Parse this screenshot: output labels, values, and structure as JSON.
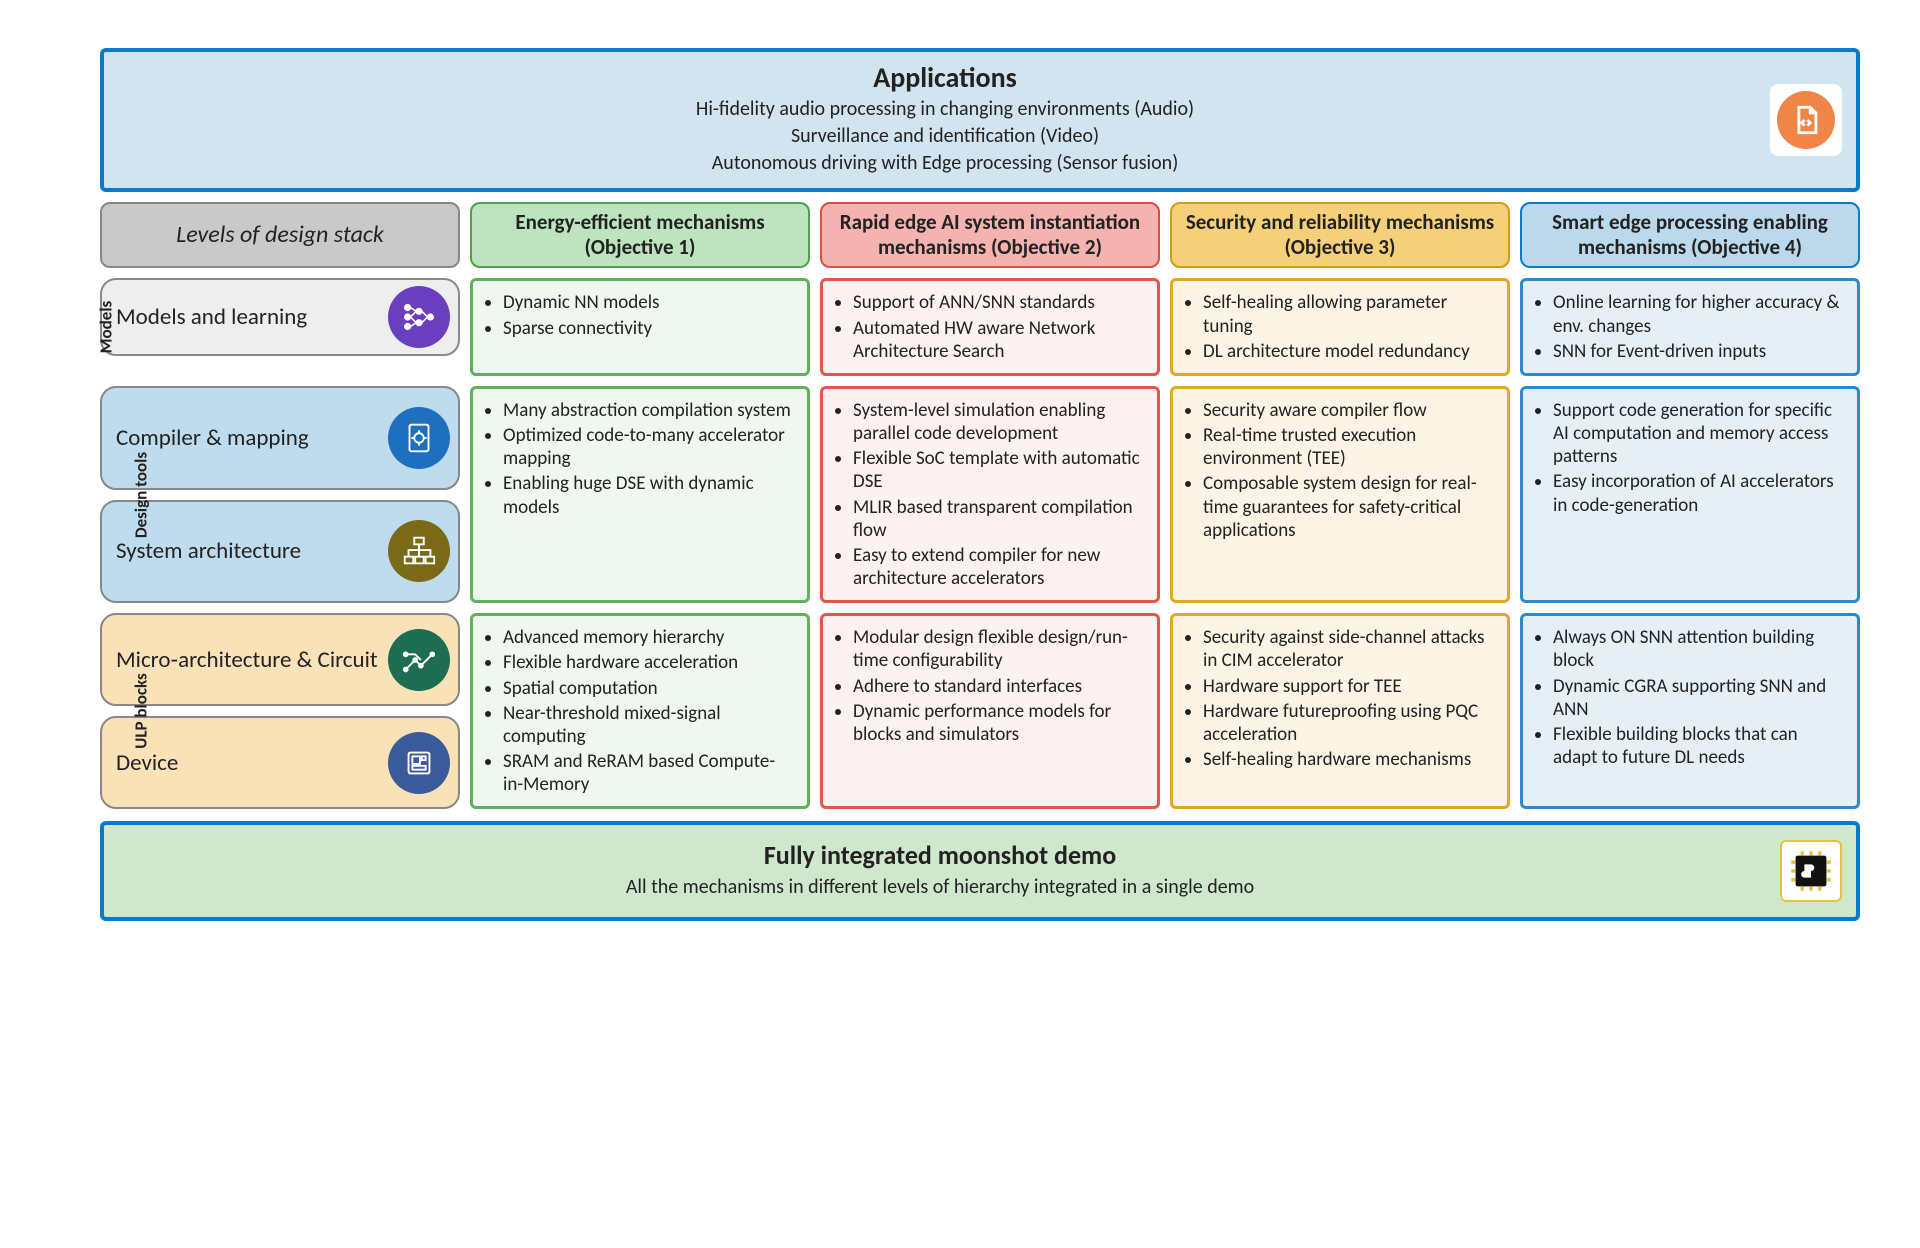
{
  "applications": {
    "title": "Applications",
    "lines": [
      "Hi-fidelity audio processing in changing environments (Audio)",
      "Surveillance and identification (Video)",
      "Autonomous driving with Edge processing (Sensor fusion)"
    ],
    "icon": "code-document-icon"
  },
  "header": {
    "levels_label": "Levels of design stack",
    "columns": [
      {
        "id": "obj1",
        "label": "Energy-efficient mechanisms (Objective 1)",
        "color": "green"
      },
      {
        "id": "obj2",
        "label": "Rapid edge AI system instantiation mechanisms (Objective 2)",
        "color": "red"
      },
      {
        "id": "obj3",
        "label": "Security and reliability mechanisms (Objective 3)",
        "color": "orange"
      },
      {
        "id": "obj4",
        "label": "Smart edge processing enabling mechanisms (Objective 4)",
        "color": "blue"
      }
    ]
  },
  "stages": {
    "models": "Models",
    "tools": "Design tools",
    "ulp": "ULP blocks"
  },
  "rows": [
    {
      "id": "models",
      "stage_key": "models",
      "left_class": "models",
      "left_items": [
        {
          "label": "Models and learning",
          "icon": "neural-net-icon",
          "icon_bg": "#6a3fbf"
        }
      ],
      "cells": {
        "obj1": [
          "Dynamic NN models",
          "Sparse connectivity"
        ],
        "obj2": [
          "Support of ANN/SNN standards",
          "Automated HW aware Network Architecture Search"
        ],
        "obj3": [
          "Self-healing allowing parameter tuning",
          "DL architecture model redundancy"
        ],
        "obj4": [
          "Online learning for higher accuracy & env. changes",
          "SNN for Event-driven inputs"
        ]
      }
    },
    {
      "id": "tools",
      "stage_key": "tools",
      "left_class": "tools",
      "left_items": [
        {
          "label": "Compiler & mapping",
          "icon": "gear-document-icon",
          "icon_bg": "#1f6fc0"
        },
        {
          "label": "System architecture",
          "icon": "hierarchy-icon",
          "icon_bg": "#7a6a18"
        }
      ],
      "cells": {
        "obj1": [
          "Many abstraction compilation system",
          "Optimized code-to-many accelerator mapping",
          "Enabling huge DSE with dynamic models"
        ],
        "obj2": [
          "System-level simulation enabling parallel code development",
          "Flexible SoC template with automatic DSE",
          "MLIR based transparent compilation flow",
          "Easy to extend compiler for new architecture accelerators"
        ],
        "obj3": [
          "Security aware compiler flow",
          "Real-time trusted execution environment (TEE)",
          "Composable system design for real-time guarantees for safety-critical applications"
        ],
        "obj4": [
          "Support code generation for specific AI computation and memory access patterns",
          "Easy incorporation of AI accelerators in code-generation"
        ]
      }
    },
    {
      "id": "ulp",
      "stage_key": "ulp",
      "left_class": "ulp",
      "left_items": [
        {
          "label": "Micro‑architecture & Circuit",
          "icon": "circuit-icon",
          "icon_bg": "#1e6d52"
        },
        {
          "label": "Device",
          "icon": "chip-icon",
          "icon_bg": "#3a5a9a"
        }
      ],
      "cells": {
        "obj1": [
          "Advanced memory hierarchy",
          "Flexible hardware acceleration",
          "Spatial computation",
          "Near-threshold mixed-signal computing",
          "SRAM and ReRAM based Compute-in-Memory"
        ],
        "obj2": [
          "Modular design flexible design/run-time configurability",
          "Adhere to standard interfaces",
          "Dynamic performance models for blocks and simulators"
        ],
        "obj3": [
          "Security against side-channel attacks in CIM accelerator",
          "Hardware support for TEE",
          "Hardware futureproofing using PQC acceleration",
          "Self-healing hardware mechanisms"
        ],
        "obj4": [
          "Always ON SNN attention building block",
          "Dynamic CGRA supporting SNN and ANN",
          "Flexible building blocks that can adapt to future DL needs"
        ]
      }
    }
  ],
  "demo": {
    "title": "Fully integrated moonshot demo",
    "sub": "All the mechanisms in different levels of hierarchy integrated in a single demo",
    "icon": "puzzle-chip-icon"
  },
  "colors": {
    "green": "#5db25a",
    "red": "#e2574a",
    "orange": "#e3a628",
    "blue": "#2c8acc"
  }
}
